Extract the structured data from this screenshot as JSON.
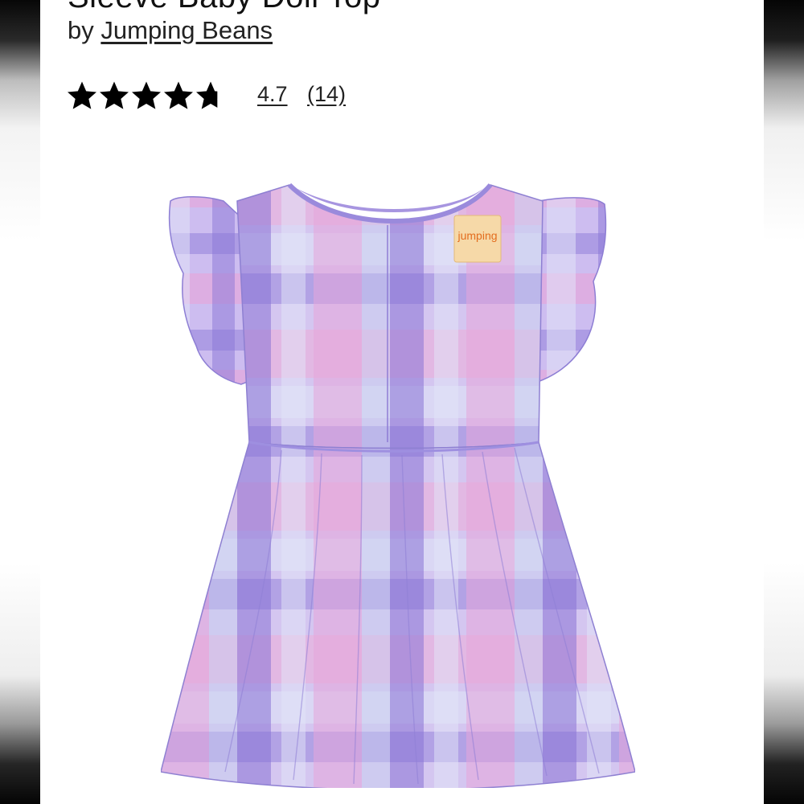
{
  "product": {
    "title": "Sleeve Baby Doll Top",
    "by_prefix": "by",
    "brand": "Jumping Beans",
    "rating_value": "4.7",
    "rating_count": "(14)",
    "stars": 4.7,
    "tag_text": "jumping"
  },
  "colors": {
    "page_bg": "#ffffff",
    "text": "#222222",
    "dress_base": "#c8b4ea",
    "dress_pink": "#e6a4d8",
    "dress_purple": "#8f7ad8",
    "dress_light": "#d9dcf5"
  },
  "icons": {
    "star": "star-icon"
  }
}
